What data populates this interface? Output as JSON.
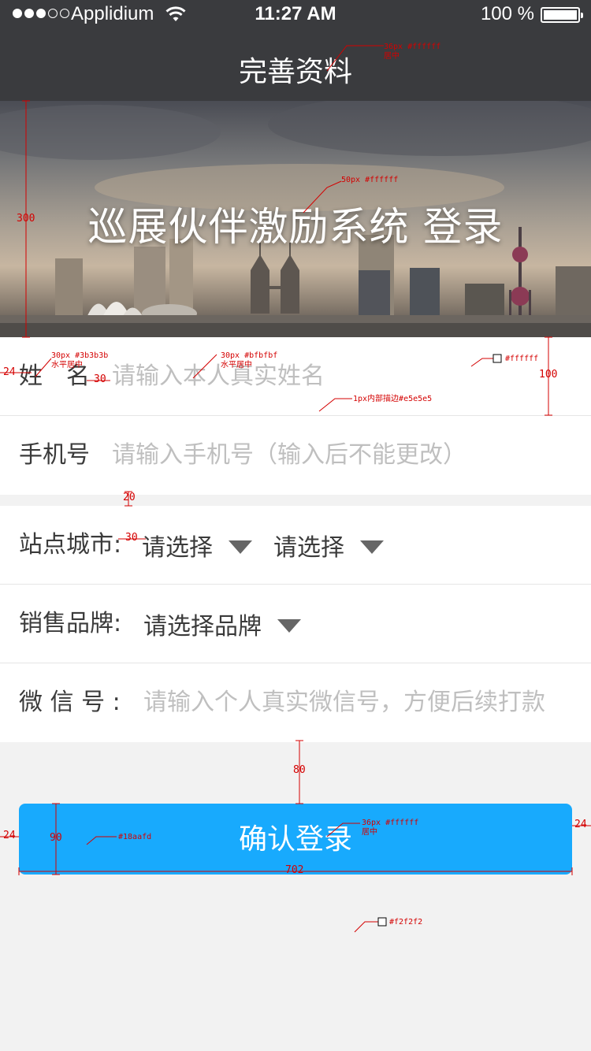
{
  "status_bar": {
    "carrier": "Applidium",
    "time": "11:27 AM",
    "battery": "100 %"
  },
  "nav": {
    "title": "完善资料"
  },
  "banner": {
    "title": "巡展伙伴激励系统 登录"
  },
  "form": {
    "name": {
      "label": "姓　名",
      "placeholder": "请输入本人真实姓名"
    },
    "phone": {
      "label": "手机号",
      "placeholder": "请输入手机号（输入后不能更改）"
    },
    "city": {
      "label": "站点城市:",
      "select1": "请选择",
      "select2": "请选择"
    },
    "brand": {
      "label": "销售品牌:",
      "select": "请选择品牌"
    },
    "wechat": {
      "label": "微 信 号 :",
      "placeholder": "请输入个人真实微信号，方便后续打款"
    }
  },
  "confirm_button": {
    "label": "确认登录"
  },
  "colors": {
    "nav_bg": "#3a3b3e",
    "label": "#3b3b3b",
    "placeholder": "#bfbfbf",
    "border": "#e5e5e5",
    "button": "#18aafd",
    "page_bg": "#f2f2f2",
    "white": "#ffffff"
  },
  "annotations": {
    "nav_title_spec": "36px #ffffff",
    "center": "居中",
    "banner_title_spec": "50px #ffffff",
    "banner_height": "300",
    "label_spec": "30px #3b3b3b",
    "placeholder_spec": "30px #bfbfbf",
    "h_center": "水平居中",
    "row_bg": "#ffffff",
    "row_height": "100",
    "left_margin": "24",
    "label_gap": "30",
    "border_spec": "1px内部描边#e5e5e5",
    "group_gap": "20",
    "select_gap": "30",
    "button_top_gap": "80",
    "button_height": "90",
    "button_color": "#18aafd",
    "button_text_spec": "36px #ffffff",
    "button_width": "702",
    "right_margin": "24",
    "page_bg": "#f2f2f2"
  }
}
